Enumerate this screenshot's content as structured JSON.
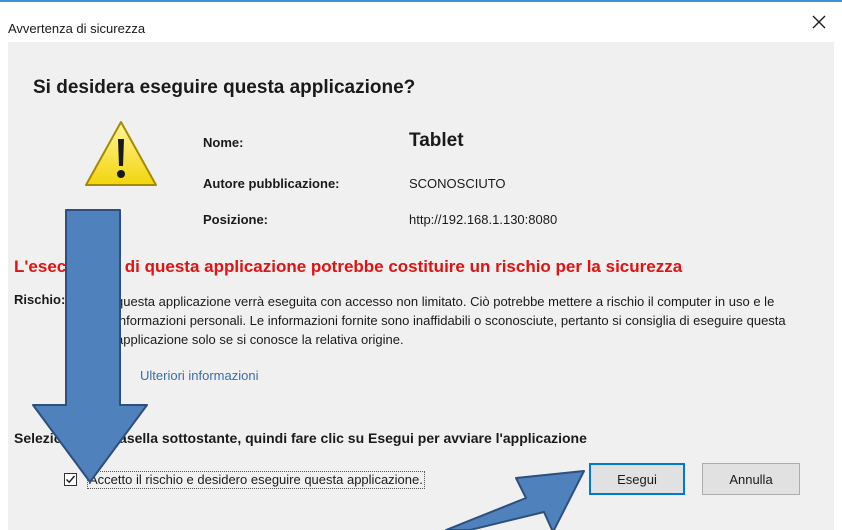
{
  "window": {
    "title": "Avvertenza di sicurezza",
    "close_label": "Chiudi"
  },
  "dialog": {
    "heading": "Si desidera eseguire questa applicazione?",
    "fields": [
      {
        "label": "Nome:",
        "value": "Tablet"
      },
      {
        "label": "Autore pubblicazione:",
        "value": "SCONOSCIUTO"
      },
      {
        "label": "Posizione:",
        "value": "http://192.168.1.130:8080"
      }
    ],
    "risk_heading": "L'esecuzione di questa applicazione potrebbe costituire un rischio per la sicurezza",
    "risk_label": "Rischio:",
    "risk_description": "questa applicazione verrà eseguita con accesso non limitato. Ciò potrebbe mettere a rischio il computer in uso e le informazioni personali. Le informazioni fornite sono inaffidabili o sconosciute, pertanto si consiglia di eseguire questa applicazione solo se si conosce la relativa origine.",
    "more_info_link": "Ulteriori informazioni",
    "instruction": "Selezionare la casella sottostante, quindi fare clic su Esegui per avviare l'applicazione",
    "accept_checkbox": {
      "label": "Accetto il rischio e desidero eseguire questa applicazione.",
      "checked": true
    },
    "buttons": {
      "run": "Esegui",
      "cancel": "Annulla"
    }
  },
  "icons": {
    "warning": "warning-triangle-icon",
    "close": "close-icon",
    "arrow": "annotation-arrow"
  },
  "colors": {
    "risk_heading": "#e21212",
    "link": "#3b6ea5",
    "arrow_fill": "#4f81bd",
    "arrow_stroke": "#2e4f7c",
    "default_button_border": "#0078d7",
    "warning_yellow": "#f7e31a"
  }
}
